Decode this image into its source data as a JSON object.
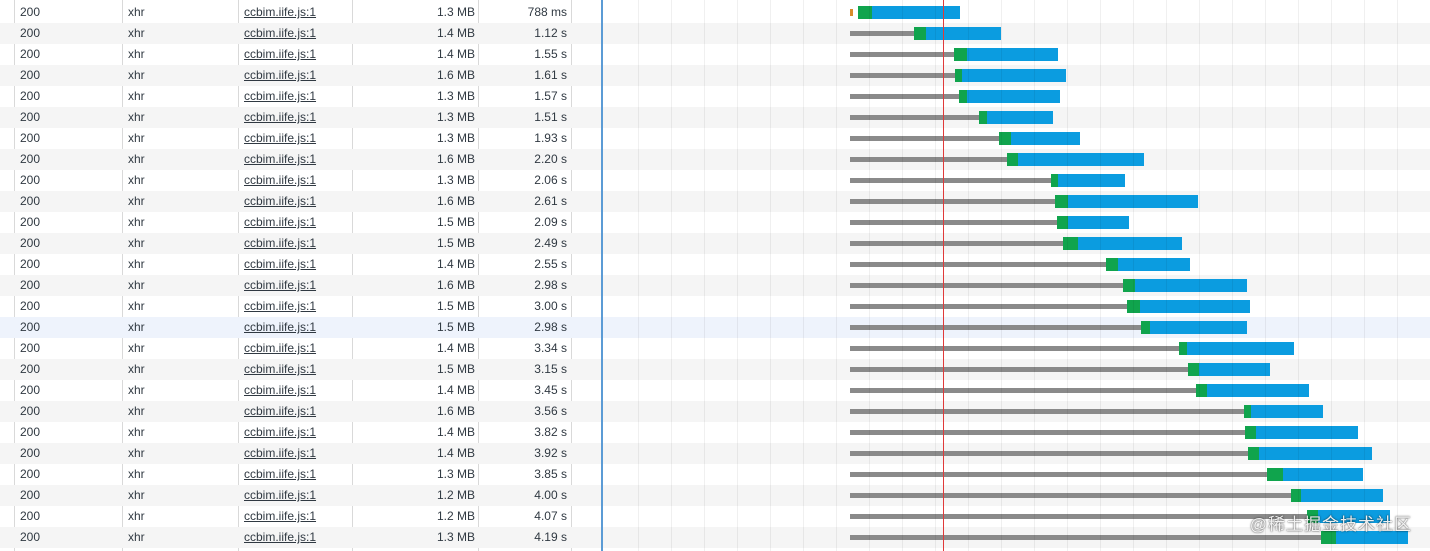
{
  "watermark": "@稀土掘金技术社区",
  "colors": {
    "waiting": "#8a8a8a",
    "ttfb": "#10a44d",
    "download": "#0b9ce0",
    "dom_content_loaded_line": "#5b9bd5",
    "load_line": "#e03a3a"
  },
  "rows": [
    {
      "status": "200",
      "type": "xhr",
      "initiator": "ccbim.iife.js:1",
      "size": "1.3 MB",
      "time": "788 ms"
    },
    {
      "status": "200",
      "type": "xhr",
      "initiator": "ccbim.iife.js:1",
      "size": "1.4 MB",
      "time": "1.12 s"
    },
    {
      "status": "200",
      "type": "xhr",
      "initiator": "ccbim.iife.js:1",
      "size": "1.4 MB",
      "time": "1.55 s"
    },
    {
      "status": "200",
      "type": "xhr",
      "initiator": "ccbim.iife.js:1",
      "size": "1.6 MB",
      "time": "1.61 s"
    },
    {
      "status": "200",
      "type": "xhr",
      "initiator": "ccbim.iife.js:1",
      "size": "1.3 MB",
      "time": "1.57 s"
    },
    {
      "status": "200",
      "type": "xhr",
      "initiator": "ccbim.iife.js:1",
      "size": "1.3 MB",
      "time": "1.51 s"
    },
    {
      "status": "200",
      "type": "xhr",
      "initiator": "ccbim.iife.js:1",
      "size": "1.3 MB",
      "time": "1.93 s"
    },
    {
      "status": "200",
      "type": "xhr",
      "initiator": "ccbim.iife.js:1",
      "size": "1.6 MB",
      "time": "2.20 s"
    },
    {
      "status": "200",
      "type": "xhr",
      "initiator": "ccbim.iife.js:1",
      "size": "1.3 MB",
      "time": "2.06 s"
    },
    {
      "status": "200",
      "type": "xhr",
      "initiator": "ccbim.iife.js:1",
      "size": "1.6 MB",
      "time": "2.61 s"
    },
    {
      "status": "200",
      "type": "xhr",
      "initiator": "ccbim.iife.js:1",
      "size": "1.5 MB",
      "time": "2.09 s"
    },
    {
      "status": "200",
      "type": "xhr",
      "initiator": "ccbim.iife.js:1",
      "size": "1.5 MB",
      "time": "2.49 s"
    },
    {
      "status": "200",
      "type": "xhr",
      "initiator": "ccbim.iife.js:1",
      "size": "1.4 MB",
      "time": "2.55 s"
    },
    {
      "status": "200",
      "type": "xhr",
      "initiator": "ccbim.iife.js:1",
      "size": "1.6 MB",
      "time": "2.98 s"
    },
    {
      "status": "200",
      "type": "xhr",
      "initiator": "ccbim.iife.js:1",
      "size": "1.5 MB",
      "time": "3.00 s"
    },
    {
      "status": "200",
      "type": "xhr",
      "initiator": "ccbim.iife.js:1",
      "size": "1.5 MB",
      "time": "2.98 s"
    },
    {
      "status": "200",
      "type": "xhr",
      "initiator": "ccbim.iife.js:1",
      "size": "1.4 MB",
      "time": "3.34 s"
    },
    {
      "status": "200",
      "type": "xhr",
      "initiator": "ccbim.iife.js:1",
      "size": "1.5 MB",
      "time": "3.15 s"
    },
    {
      "status": "200",
      "type": "xhr",
      "initiator": "ccbim.iife.js:1",
      "size": "1.4 MB",
      "time": "3.45 s"
    },
    {
      "status": "200",
      "type": "xhr",
      "initiator": "ccbim.iife.js:1",
      "size": "1.6 MB",
      "time": "3.56 s"
    },
    {
      "status": "200",
      "type": "xhr",
      "initiator": "ccbim.iife.js:1",
      "size": "1.4 MB",
      "time": "3.82 s"
    },
    {
      "status": "200",
      "type": "xhr",
      "initiator": "ccbim.iife.js:1",
      "size": "1.4 MB",
      "time": "3.92 s"
    },
    {
      "status": "200",
      "type": "xhr",
      "initiator": "ccbim.iife.js:1",
      "size": "1.3 MB",
      "time": "3.85 s"
    },
    {
      "status": "200",
      "type": "xhr",
      "initiator": "ccbim.iife.js:1",
      "size": "1.2 MB",
      "time": "4.00 s"
    },
    {
      "status": "200",
      "type": "xhr",
      "initiator": "ccbim.iife.js:1",
      "size": "1.2 MB",
      "time": "4.07 s"
    },
    {
      "status": "200",
      "type": "xhr",
      "initiator": "ccbim.iife.js:1",
      "size": "1.3 MB",
      "time": "4.19 s"
    }
  ]
}
